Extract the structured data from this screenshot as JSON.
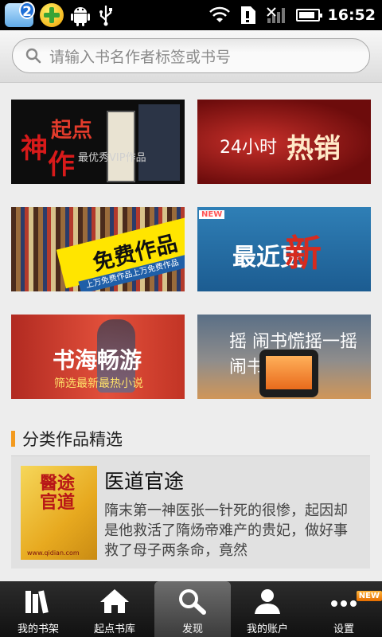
{
  "status_bar": {
    "notification_count": "2",
    "time": "16:52",
    "battery_level": 0.85,
    "icons": [
      "app-badge-icon",
      "plus-icon",
      "android-icon",
      "usb-icon",
      "wifi-icon",
      "sim-icon",
      "signal-icon",
      "battery-icon"
    ]
  },
  "search": {
    "placeholder": "请输入书名作者标签或书号",
    "icon": "search-icon"
  },
  "banners": [
    {
      "text_a": "神",
      "text_b": "起点",
      "text_c": "作",
      "subtitle": "最优秀VIP作品"
    },
    {
      "text": "24小时",
      "text_strong": "热销"
    },
    {
      "title": "免费作品",
      "subtitle": "上万免费作品上万免费作品"
    },
    {
      "tag": "NEW",
      "text": "最近更",
      "text_strong": "新"
    },
    {
      "title": "书海畅游",
      "subtitle": "筛选最新最热小说"
    },
    {
      "text": "摇 闹书慌摇一摇 闹书"
    }
  ],
  "section": {
    "title": "分类作品精选"
  },
  "book": {
    "title": "医道官途",
    "cover_text": "醫途官道",
    "cover_url": "www.qidian.com",
    "description": "隋末第一神医张一针死的很惨，起因却是他救活了隋炀帝难产的贵妃，做好事救了母子两条命，竟然"
  },
  "nav": {
    "items": [
      {
        "label": "我的书架",
        "icon": "bookshelf-icon"
      },
      {
        "label": "起点书库",
        "icon": "home-icon"
      },
      {
        "label": "发现",
        "icon": "search-icon"
      },
      {
        "label": "我的账户",
        "icon": "user-icon"
      },
      {
        "label": "设置",
        "icon": "more-icon"
      }
    ],
    "active_index": 2,
    "settings_badge": "NEW"
  }
}
